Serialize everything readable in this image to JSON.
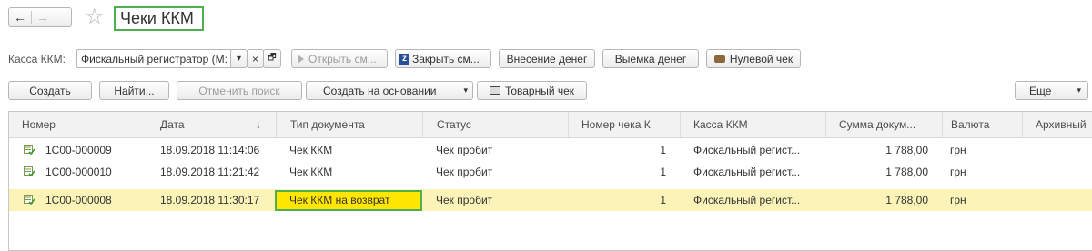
{
  "window": {
    "title": "Чеки ККМ",
    "nav_back": "←",
    "nav_forward": "→",
    "star": "☆"
  },
  "toolbar1": {
    "kassa_label": "Касса ККМ:",
    "kassa_value": "Фискальный регистратор (М:",
    "dropdown_glyph": "▾",
    "clear_glyph": "×",
    "open_glyph": "🗗",
    "open_shift": "Открыть см...",
    "close_shift": "Закрыть см...",
    "deposit": "Внесение денег",
    "withdraw": "Выемка денег",
    "zero_check": "Нулевой чек"
  },
  "toolbar2": {
    "create": "Создать",
    "find": "Найти...",
    "cancel_search": "Отменить поиск",
    "create_based": "Создать на основании",
    "goods_check": "Товарный чек",
    "more": "Еще"
  },
  "table": {
    "columns": [
      "Номер",
      "Дата",
      "Тип документа",
      "Статус",
      "Номер чека К",
      "Касса ККМ",
      "Сумма докум...",
      "Валюта",
      "Архивный"
    ],
    "sort_indicator": "↓",
    "rows": [
      {
        "number": "1С00-000009",
        "date": "18.09.2018 11:14:06",
        "type": "Чек ККМ",
        "status": "Чек пробит",
        "check_no": "1",
        "kassa": "Фискальный регист...",
        "sum": "1 788,00",
        "currency": "грн",
        "archive": "",
        "selected": false
      },
      {
        "number": "1С00-000010",
        "date": "18.09.2018 11:21:42",
        "type": "Чек ККМ",
        "status": "Чек пробит",
        "check_no": "1",
        "kassa": "Фискальный регист...",
        "sum": "1 788,00",
        "currency": "грн",
        "archive": "",
        "selected": false
      },
      {
        "number": "1С00-000008",
        "date": "18.09.2018 11:30:17",
        "type": "Чек ККМ на возврат",
        "status": "Чек пробит",
        "check_no": "1",
        "kassa": "Фискальный регист...",
        "sum": "1 788,00",
        "currency": "грн",
        "archive": "",
        "selected": true
      }
    ]
  },
  "colors": {
    "highlight_border": "#4caf50",
    "selected_row": "#fbf3b8",
    "type_highlight": "#ffe600"
  }
}
